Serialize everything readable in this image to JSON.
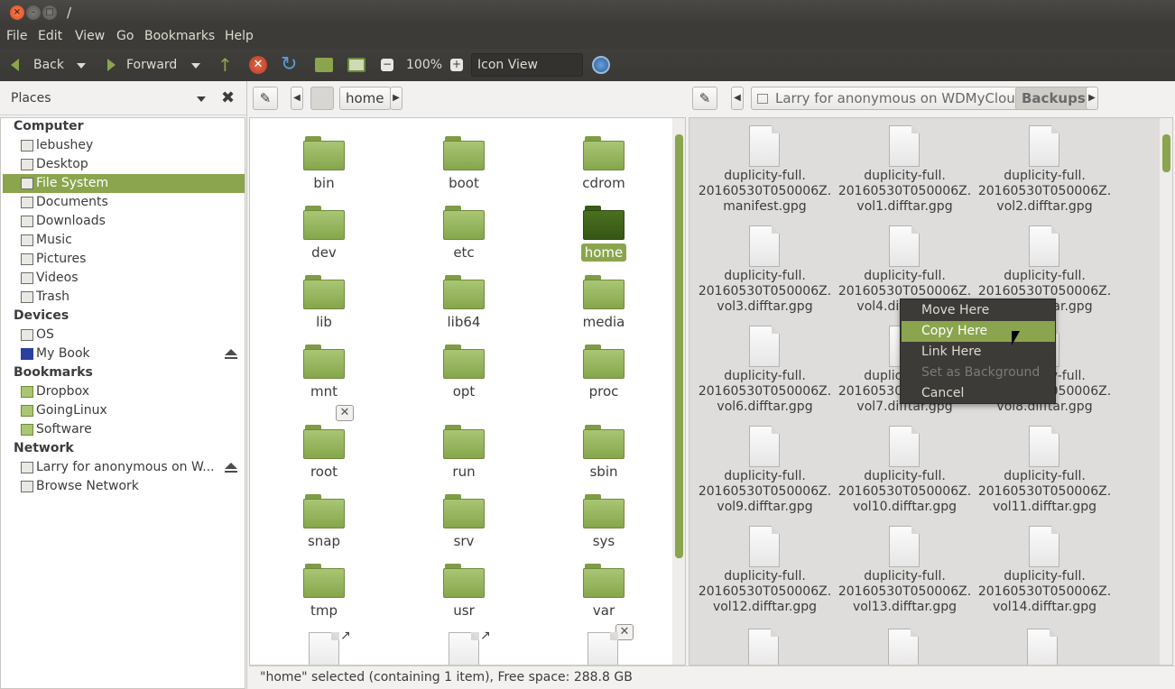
{
  "window": {
    "title": "/"
  },
  "menubar": [
    "File",
    "Edit",
    "View",
    "Go",
    "Bookmarks",
    "Help"
  ],
  "toolbar": {
    "back": "Back",
    "forward": "Forward",
    "zoom": "100%",
    "view_mode": "Icon View"
  },
  "sidebar": {
    "header": "Places",
    "sections": {
      "computer": "Computer",
      "devices": "Devices",
      "bookmarks": "Bookmarks",
      "network": "Network"
    },
    "computer_items": [
      "lebushey",
      "Desktop",
      "File System",
      "Documents",
      "Downloads",
      "Music",
      "Pictures",
      "Videos",
      "Trash"
    ],
    "device_items": [
      "OS",
      "My Book"
    ],
    "bookmark_items": [
      "Dropbox",
      "GoingLinux",
      "Software"
    ],
    "network_items": [
      "Larry for anonymous on W...",
      "Browse Network"
    ]
  },
  "left_location": {
    "crumb": "home"
  },
  "right_location": {
    "crumb1": "Larry for anonymous on WDMyCloud",
    "crumb2": "Backups"
  },
  "left_files": [
    "bin",
    "boot",
    "cdrom",
    "dev",
    "etc",
    "home",
    "lib",
    "lib64",
    "media",
    "mnt",
    "opt",
    "proc",
    "root",
    "run",
    "sbin",
    "snap",
    "srv",
    "sys",
    "tmp",
    "usr",
    "var"
  ],
  "right_files": [
    "duplicity-full.\n20160530T050006Z.\nmanifest.gpg",
    "duplicity-full.\n20160530T050006Z.\nvol1.difftar.gpg",
    "duplicity-full.\n20160530T050006Z.\nvol2.difftar.gpg",
    "duplicity-full.\n20160530T050006Z.\nvol3.difftar.gpg",
    "duplicity-full.\n20160530T050006Z.\nvol4.difftar.gpg",
    "duplicity-full.\n20160530T050006Z.\nvol5.difftar.gpg",
    "duplicity-full.\n20160530T050006Z.\nvol6.difftar.gpg",
    "duplicity-full.\n20160530T050006Z.\nvol7.difftar.gpg",
    "duplicity-full.\n20160530T050006Z.\nvol8.difftar.gpg",
    "duplicity-full.\n20160530T050006Z.\nvol9.difftar.gpg",
    "duplicity-full.\n20160530T050006Z.\nvol10.difftar.gpg",
    "duplicity-full.\n20160530T050006Z.\nvol11.difftar.gpg",
    "duplicity-full.\n20160530T050006Z.\nvol12.difftar.gpg",
    "duplicity-full.\n20160530T050006Z.\nvol13.difftar.gpg",
    "duplicity-full.\n20160530T050006Z.\nvol14.difftar.gpg"
  ],
  "context_menu": [
    "Move Here",
    "Copy Here",
    "Link Here",
    "Set as Background",
    "Cancel"
  ],
  "status": "\"home\" selected (containing 1 item), Free space: 288.8 GB",
  "colors": {
    "accent": "#8aa54d",
    "chrome": "#3c3b37"
  }
}
